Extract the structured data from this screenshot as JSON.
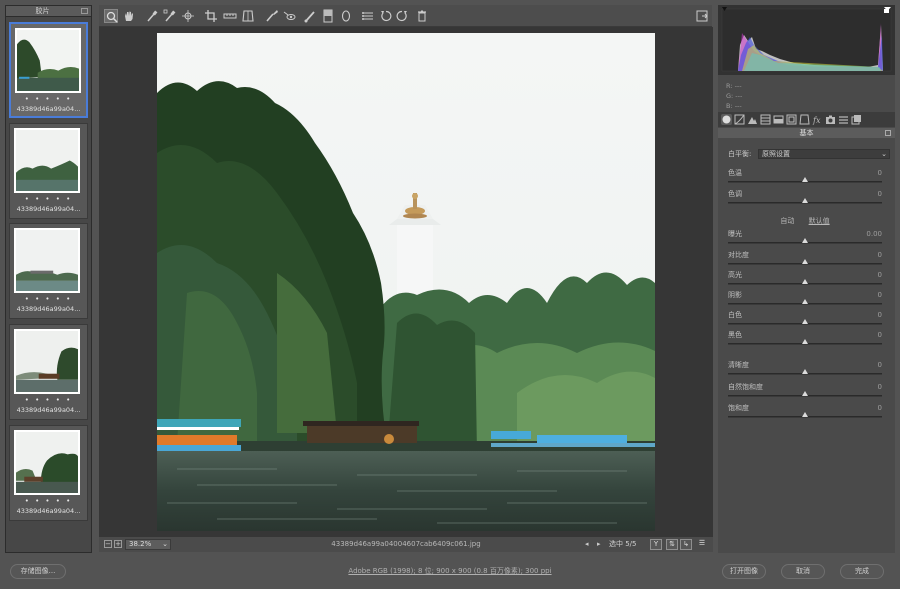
{
  "filmstrip": {
    "title": "胶片",
    "thumbnails": [
      {
        "name": "43389d46a99a04...",
        "rating": "• • • • •",
        "selected": true
      },
      {
        "name": "43389d46a99a04...",
        "rating": "• • • • •",
        "selected": false
      },
      {
        "name": "43389d46a99a04...",
        "rating": "• • • • •",
        "selected": false
      },
      {
        "name": "43389d46a99a04...",
        "rating": "• • • • •",
        "selected": false
      },
      {
        "name": "43389d46a99a04...",
        "rating": "• • • • •",
        "selected": false
      }
    ]
  },
  "toolbar": {
    "tools": [
      "zoom-tool-icon",
      "hand-tool-icon",
      "white-balance-icon",
      "color-sampler-icon",
      "target-adjust-icon",
      "crop-icon",
      "straighten-icon",
      "transform-icon",
      "spot-removal-icon",
      "red-eye-icon",
      "adjustment-brush-icon",
      "graduated-filter-icon",
      "radial-filter-icon",
      "preferences-icon",
      "rotate-left-icon",
      "rotate-right-icon",
      "trash-icon"
    ],
    "right_tool": "fullscreen-toggle-icon"
  },
  "status": {
    "zoom": "38.2%",
    "filename": "43389d46a99a04004607cab6409c061.jpg",
    "selection": "选中 5/5"
  },
  "histogram": {
    "r": "R:  ---",
    "g": "G:  ---",
    "b": "B:  ---"
  },
  "panel": {
    "section_title": "基本",
    "white_balance_label": "白平衡:",
    "white_balance_value": "原照设置",
    "auto_label": "自动",
    "default_label": "默认值",
    "sliders": [
      {
        "label": "色温",
        "value": "0",
        "pos": 0.5
      },
      {
        "label": "色调",
        "value": "0",
        "pos": 0.5
      },
      {
        "label": "曝光",
        "value": "0.00",
        "pos": 0.5
      },
      {
        "label": "对比度",
        "value": "0",
        "pos": 0.5
      },
      {
        "label": "高光",
        "value": "0",
        "pos": 0.5
      },
      {
        "label": "阴影",
        "value": "0",
        "pos": 0.5
      },
      {
        "label": "白色",
        "value": "0",
        "pos": 0.5
      },
      {
        "label": "黑色",
        "value": "0",
        "pos": 0.5
      },
      {
        "label": "清晰度",
        "value": "0",
        "pos": 0.5
      },
      {
        "label": "自然饱和度",
        "value": "0",
        "pos": 0.5
      },
      {
        "label": "饱和度",
        "value": "0",
        "pos": 0.5
      }
    ]
  },
  "bottom": {
    "save_label": "存储图像...",
    "workflow": "Adobe RGB (1998); 8 位; 900 x 900 (0.8 百万像素); 300 ppi",
    "open_label": "打开图像",
    "cancel_label": "取消",
    "done_label": "完成"
  },
  "colors": {
    "accent": "#4a7cd8",
    "panel": "#4a4a4a",
    "preview_bg": "#363636"
  }
}
